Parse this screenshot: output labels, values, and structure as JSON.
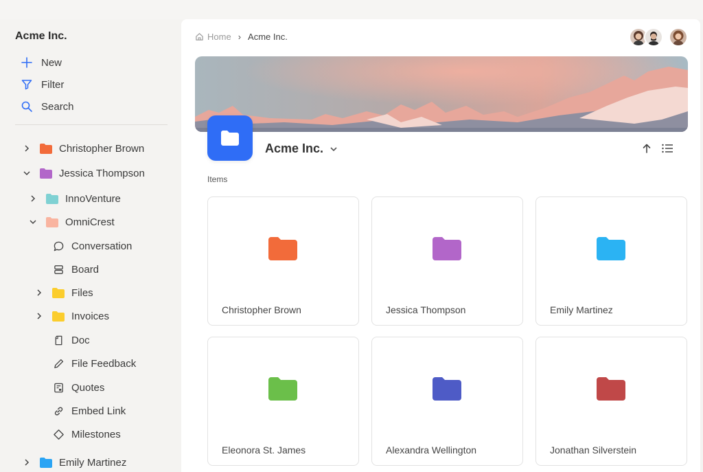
{
  "sidebar": {
    "workspace_title": "Acme Inc.",
    "actions": [
      {
        "label": "New",
        "icon": "plus-icon"
      },
      {
        "label": "Filter",
        "icon": "filter-icon"
      },
      {
        "label": "Search",
        "icon": "search-icon"
      }
    ],
    "tree": [
      {
        "label": "Christopher Brown",
        "icon": "folder-icon",
        "color": "#f26b3a",
        "expanded": false
      },
      {
        "label": "Jessica Thompson",
        "icon": "folder-icon",
        "color": "#b266c9",
        "expanded": true
      },
      {
        "label": "InnoVenture",
        "icon": "folder-icon",
        "color": "#7fd1d3",
        "expanded": false
      },
      {
        "label": "OmniCrest",
        "icon": "folder-icon",
        "color": "#f9b4a0",
        "expanded": true
      },
      {
        "label": "Conversation",
        "icon": "chat-bubble-icon"
      },
      {
        "label": "Board",
        "icon": "board-icon"
      },
      {
        "label": "Files",
        "icon": "folder-icon",
        "color": "#fbcd2d",
        "expanded": false
      },
      {
        "label": "Invoices",
        "icon": "folder-icon",
        "color": "#fbcd2d",
        "expanded": false
      },
      {
        "label": "Doc",
        "icon": "document-icon"
      },
      {
        "label": "File Feedback",
        "icon": "pen-icon"
      },
      {
        "label": "Quotes",
        "icon": "quote-sheet-icon"
      },
      {
        "label": "Embed Link",
        "icon": "link-icon"
      },
      {
        "label": "Milestones",
        "icon": "diamond-icon"
      },
      {
        "label": "Emily Martinez",
        "icon": "folder-icon",
        "color": "#2aa4f4",
        "expanded": false
      }
    ]
  },
  "header": {
    "breadcrumb": {
      "home": "Home",
      "current": "Acme Inc."
    }
  },
  "workspace": {
    "title": "Acme Inc.",
    "icon_color": "#2f6df6",
    "items_label": "Items"
  },
  "items": [
    {
      "label": "Christopher Brown",
      "color": "#f26b3a"
    },
    {
      "label": "Jessica Thompson",
      "color": "#b266c9"
    },
    {
      "label": "Emily Martinez",
      "color": "#2bb3f3"
    },
    {
      "label": "Eleonora St. James",
      "color": "#6bbf4a"
    },
    {
      "label": "Alexandra Wellington",
      "color": "#4e5bc6"
    },
    {
      "label": "Jonathan Silverstein",
      "color": "#c04848"
    }
  ]
}
